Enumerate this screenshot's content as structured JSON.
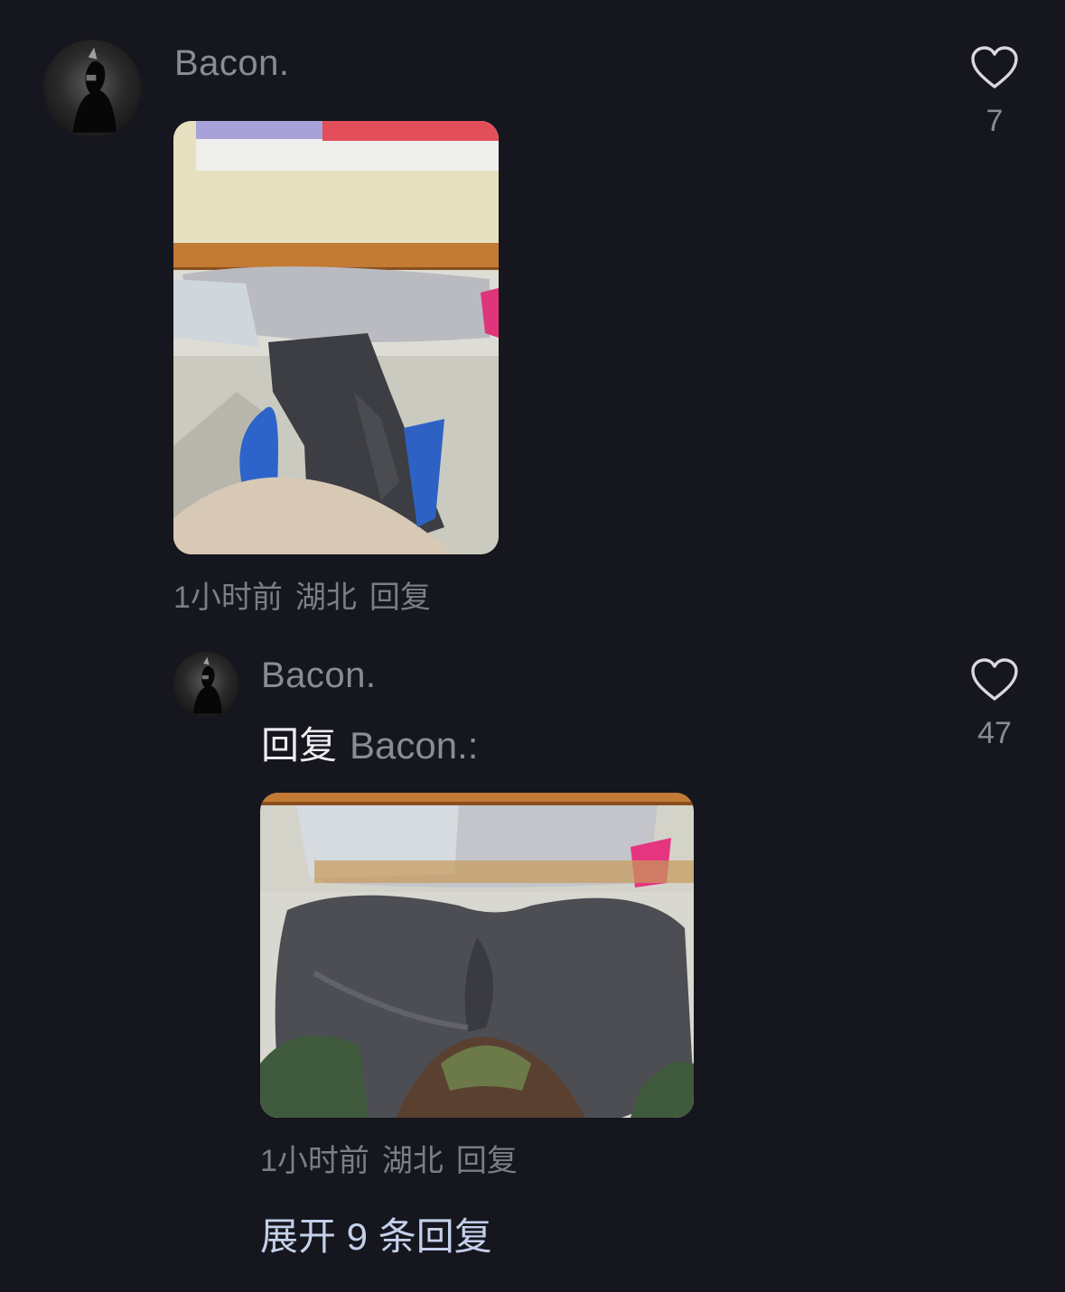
{
  "comment": {
    "username": "Bacon.",
    "like_count": "7",
    "meta": {
      "time": "1小时前",
      "location": "湖北",
      "reply": "回复"
    }
  },
  "reply": {
    "username": "Bacon.",
    "reply_prefix": "回复",
    "reply_target": "Bacon.:",
    "like_count": "47",
    "meta": {
      "time": "1小时前",
      "location": "湖北",
      "reply": "回复"
    }
  },
  "expand_replies": "展开 9 条回复",
  "colors": {
    "background": "#16161e",
    "link": "#c4d0ea",
    "muted": "#8b8b94"
  },
  "icons": {
    "like": "heart-outline-icon"
  }
}
